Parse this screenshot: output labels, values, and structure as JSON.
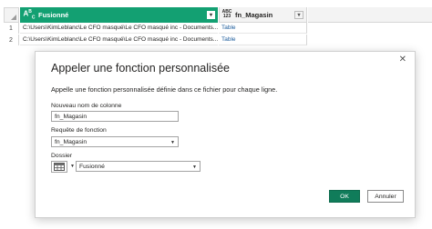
{
  "grid": {
    "columns": [
      {
        "type_icon": "Aᴮᶜ",
        "label": "Fusionné"
      },
      {
        "type_icon": "ABC 123",
        "label": "fn_Magasin"
      }
    ],
    "rows": [
      {
        "num": "1",
        "path": "C:\\Users\\KimLeblanc\\Le CFO masqué\\Le CFO masqué inc - Documents...",
        "value": "Table"
      },
      {
        "num": "2",
        "path": "C:\\Users\\KimLeblanc\\Le CFO masqué\\Le CFO masqué inc - Documents...",
        "value": "Table"
      }
    ]
  },
  "dialog": {
    "title": "Appeler une fonction personnalisée",
    "close": "✕",
    "description": "Appelle une fonction personnalisée définie dans ce fichier pour chaque ligne.",
    "new_column_label": "Nouveau nom de colonne",
    "new_column_value": "fn_Magasin",
    "function_query_label": "Requête de fonction",
    "function_query_value": "fn_Magasin",
    "folder_label": "Dossier",
    "folder_value": "Fusionné",
    "ok_label": "OK",
    "cancel_label": "Annuler"
  },
  "icons": {
    "column_type": "text-type-icon",
    "any_type": "any-type-icon",
    "table_picker": "table-icon",
    "dropdown": "chevron-down-icon"
  },
  "colors": {
    "header_accent": "#13a072",
    "ok_button": "#107c5a",
    "link": "#1e5d9c"
  }
}
